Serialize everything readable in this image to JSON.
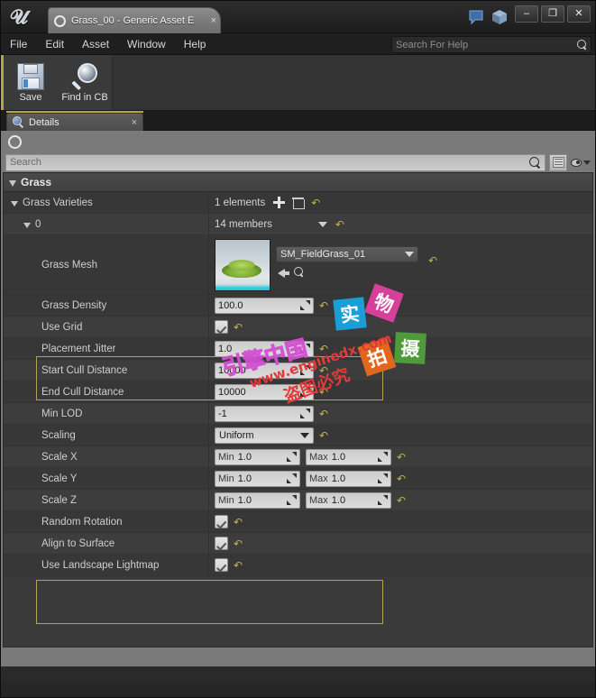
{
  "window": {
    "tab_title": "Grass_00 - Generic Asset E",
    "tab_close": "×",
    "minimize": "–",
    "maximize": "❐",
    "close": "✕"
  },
  "menubar": {
    "items": [
      "File",
      "Edit",
      "Asset",
      "Window",
      "Help"
    ],
    "help_search_placeholder": "Search For Help"
  },
  "toolbar": {
    "buttons": [
      {
        "label": "Save",
        "icon": "floppy-disk-icon"
      },
      {
        "label": "Find in CB",
        "icon": "magnifier-icon"
      }
    ]
  },
  "details_tab": {
    "label": "Details",
    "close": "×"
  },
  "details_panel": {
    "search_placeholder": "Search"
  },
  "tree": {
    "category": "Grass",
    "array": {
      "label": "Grass Varieties",
      "count": "1 elements"
    },
    "element": {
      "label": "0",
      "members": "14 members"
    },
    "mesh": {
      "label": "Grass Mesh",
      "asset": "SM_FieldGrass_01"
    },
    "rows": [
      {
        "label": "Grass Density",
        "kind": "num",
        "value": "100.0"
      },
      {
        "label": "Use Grid",
        "kind": "check",
        "value": "checked"
      },
      {
        "label": "Placement Jitter",
        "kind": "num",
        "value": "1.0"
      },
      {
        "label": "Start Cull Distance",
        "kind": "num",
        "value": "10000"
      },
      {
        "label": "End Cull Distance",
        "kind": "num",
        "value": "10000"
      },
      {
        "label": "Min LOD",
        "kind": "num",
        "value": "-1"
      },
      {
        "label": "Scaling",
        "kind": "select",
        "value": "Uniform"
      },
      {
        "label": "Scale X",
        "kind": "minmax",
        "min_prefix": "Min",
        "min": "1.0",
        "max_prefix": "Max",
        "max": "1.0"
      },
      {
        "label": "Scale Y",
        "kind": "minmax",
        "min_prefix": "Min",
        "min": "1.0",
        "max_prefix": "Max",
        "max": "1.0"
      },
      {
        "label": "Scale Z",
        "kind": "minmax",
        "min_prefix": "Min",
        "min": "1.0",
        "max_prefix": "Max",
        "max": "1.0"
      },
      {
        "label": "Random Rotation",
        "kind": "check",
        "value": "checked"
      },
      {
        "label": "Align to Surface",
        "kind": "check",
        "value": "checked"
      },
      {
        "label": "Use Landscape Lightmap",
        "kind": "check",
        "value": "checked"
      }
    ]
  },
  "watermarks": {
    "tiles": [
      {
        "char": "实",
        "color": "#1b9ed8"
      },
      {
        "char": "物",
        "color": "#d6409a"
      },
      {
        "char": "拍",
        "color": "#e2661d"
      },
      {
        "char": "摄",
        "color": "#4f9b3c"
      }
    ],
    "brand": "引擎中国",
    "brand_color": "#d24fd2",
    "site": "www.enginedx.com",
    "site_color": "#e03a3a",
    "notice": "盗图必究",
    "notice_color": "#e03a3a"
  },
  "colors": {
    "accent_yellow": "#b8a43c",
    "panel_bg": "#7a7a7a",
    "tree_bg": "#3a3a3a",
    "revert_arrow": "#c5b24a"
  }
}
